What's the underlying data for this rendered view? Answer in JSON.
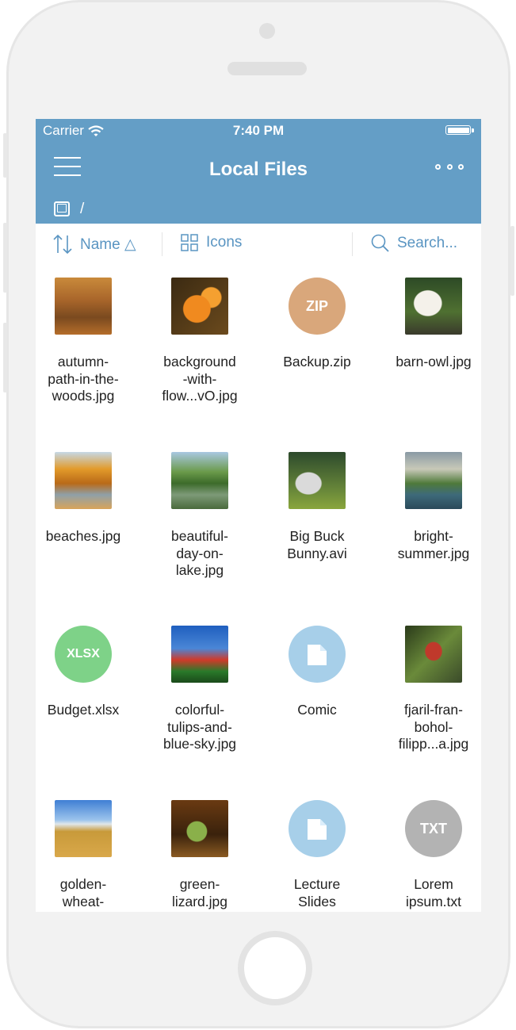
{
  "status_bar": {
    "carrier": "Carrier",
    "time": "7:40 PM"
  },
  "nav": {
    "title": "Local Files",
    "path": "/"
  },
  "toolbar": {
    "sort_label": "Name △",
    "view_label": "Icons",
    "search_placeholder": "Search..."
  },
  "icons": {
    "menu": "hamburger-menu-icon",
    "more": "more-dots-icon",
    "device": "tablet-device-icon",
    "sort": "sort-arrows-icon",
    "view": "grid-view-icon",
    "search": "search-icon",
    "folder": "folder-icon"
  },
  "colors": {
    "nav": "#649ec6",
    "accent": "#5a95c2",
    "zip": "#d9a77b",
    "xlsx": "#7ed288",
    "folder": "#a7cfe9",
    "txt": "#b3b3b3"
  },
  "files": [
    {
      "name": "autumn-path-in-the-woods.jpg",
      "label_lines": [
        "autumn-",
        "path-in-the-",
        "woods.jpg"
      ],
      "kind": "image"
    },
    {
      "name": "background-with-flow...vO.jpg",
      "label_lines": [
        "background",
        "-with-",
        "flow...vO.jpg"
      ],
      "kind": "image"
    },
    {
      "name": "Backup.zip",
      "label_lines": [
        "Backup.zip"
      ],
      "kind": "zip",
      "badge": "ZIP"
    },
    {
      "name": "barn-owl.jpg",
      "label_lines": [
        "barn-owl.jpg"
      ],
      "kind": "image"
    },
    {
      "name": "beaches.jpg",
      "label_lines": [
        "beaches.jpg"
      ],
      "kind": "image"
    },
    {
      "name": "beautiful-day-on-lake.jpg",
      "label_lines": [
        "beautiful-",
        "day-on-",
        "lake.jpg"
      ],
      "kind": "image"
    },
    {
      "name": "Big Buck Bunny.avi",
      "label_lines": [
        "Big Buck",
        "Bunny.avi"
      ],
      "kind": "video"
    },
    {
      "name": "bright-summer.jpg",
      "label_lines": [
        "bright-",
        "summer.jpg"
      ],
      "kind": "image"
    },
    {
      "name": "Budget.xlsx",
      "label_lines": [
        "Budget.xlsx"
      ],
      "kind": "xlsx",
      "badge": "XLSX"
    },
    {
      "name": "colorful-tulips-and-blue-sky.jpg",
      "label_lines": [
        "colorful-",
        "tulips-and-",
        "blue-sky.jpg"
      ],
      "kind": "image"
    },
    {
      "name": "Comic",
      "label_lines": [
        "Comic"
      ],
      "kind": "folder"
    },
    {
      "name": "fjaril-fran-bohol-filipp...a.jpg",
      "label_lines": [
        "fjaril-fran-",
        "bohol-",
        "filipp...a.jpg"
      ],
      "kind": "image"
    },
    {
      "name": "golden-wheat-",
      "label_lines": [
        "golden-",
        "wheat-"
      ],
      "kind": "image"
    },
    {
      "name": "green-lizard.jpg",
      "label_lines": [
        "green-",
        "lizard.jpg"
      ],
      "kind": "image"
    },
    {
      "name": "Lecture Slides",
      "label_lines": [
        "Lecture",
        "Slides"
      ],
      "kind": "folder"
    },
    {
      "name": "Lorem ipsum.txt",
      "label_lines": [
        "Lorem",
        "ipsum.txt"
      ],
      "kind": "txt",
      "badge": "TXT"
    }
  ]
}
